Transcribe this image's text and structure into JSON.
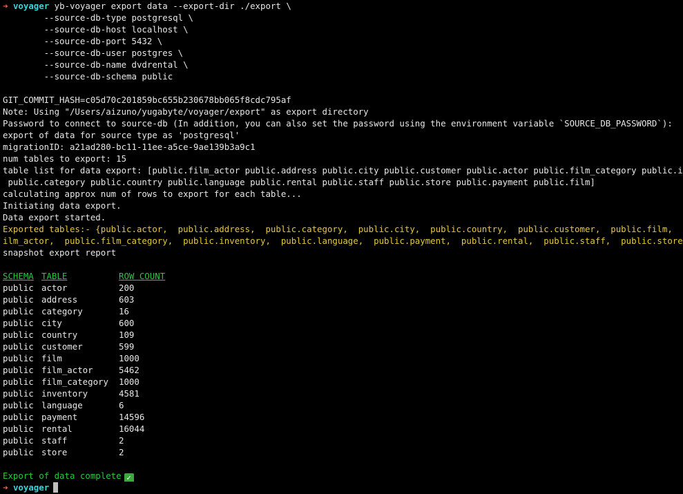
{
  "prompt": {
    "arrow": "➜",
    "dir": "voyager"
  },
  "command": {
    "first": "yb-voyager export data --export-dir ./export \\",
    "args": [
      "        --source-db-type postgresql \\",
      "        --source-db-host localhost \\",
      "        --source-db-port 5432 \\",
      "        --source-db-user postgres \\",
      "        --source-db-name dvdrental \\",
      "        --source-db-schema public"
    ]
  },
  "output": {
    "git_hash": "GIT_COMMIT_HASH=c05d70c201859bc655b230678bb065f8cdc795af",
    "note_dir": "Note: Using \"/Users/aizuno/yugabyte/voyager/export\" as export directory",
    "password": "Password to connect to source-db (In addition, you can also set the password using the environment variable `SOURCE_DB_PASSWORD`):",
    "export_type": "export of data for source type as 'postgresql'",
    "migration_id": "migrationID: a21ad280-bc11-11ee-a5ce-9ae139b3a9c1",
    "num_tables": "num tables to export: 15",
    "table_list_1": "table list for data export: [public.film_actor public.address public.city public.customer public.actor public.film_category public.inventory",
    "table_list_2": " public.category public.country public.language public.rental public.staff public.store public.payment public.film]",
    "calculating": "calculating approx num of rows to export for each table...",
    "initiating": "Initiating data export.",
    "started": "Data export started.",
    "exported_1": "Exported tables:- {public.actor,  public.address,  public.category,  public.city,  public.country,  public.customer,  public.film,  public.f",
    "exported_2": "ilm_actor,  public.film_category,  public.inventory,  public.language,  public.payment,  public.rental,  public.staff,  public.store}",
    "report_title": "snapshot export report",
    "complete": "Export of data complete",
    "check": "✓"
  },
  "report": {
    "headers": [
      "SCHEMA",
      "TABLE",
      "ROW COUNT"
    ],
    "rows": [
      [
        "public",
        "actor",
        "200"
      ],
      [
        "public",
        "address",
        "603"
      ],
      [
        "public",
        "category",
        "16"
      ],
      [
        "public",
        "city",
        "600"
      ],
      [
        "public",
        "country",
        "109"
      ],
      [
        "public",
        "customer",
        "599"
      ],
      [
        "public",
        "film",
        "1000"
      ],
      [
        "public",
        "film_actor",
        "5462"
      ],
      [
        "public",
        "film_category",
        "1000"
      ],
      [
        "public",
        "inventory",
        "4581"
      ],
      [
        "public",
        "language",
        "6"
      ],
      [
        "public",
        "payment",
        "14596"
      ],
      [
        "public",
        "rental",
        "16044"
      ],
      [
        "public",
        "staff",
        "2"
      ],
      [
        "public",
        "store",
        "2"
      ]
    ]
  },
  "colors": {
    "background": "#000000",
    "text": "#e6e6e6",
    "prompt_arrow": "#ff5f57",
    "prompt_dir": "#39d3dc",
    "highlight": "#e5c63a",
    "success": "#27c93f"
  }
}
